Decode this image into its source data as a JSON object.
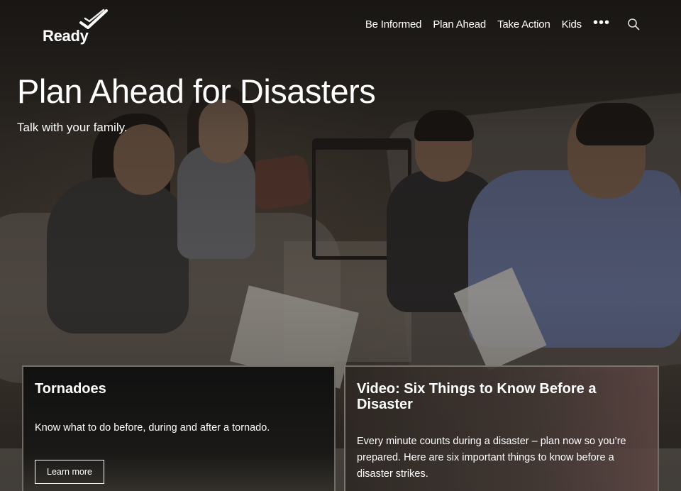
{
  "header": {
    "logo_text": "Ready",
    "nav": [
      "Be Informed",
      "Plan Ahead",
      "Take Action",
      "Kids"
    ],
    "more_label": "•••",
    "icons": {
      "more": "more-dots-icon",
      "search": "search-icon"
    }
  },
  "hero": {
    "title": "Plan Ahead for Disasters",
    "subtitle": "Talk with your family."
  },
  "cards": [
    {
      "title": "Tornadoes",
      "text": "Know what to do before, during and after a tornado.",
      "button": "Learn more"
    },
    {
      "title": "Video: Six Things to Know Before a Disaster",
      "text": "Every minute counts during a disaster – plan now so you’re prepared. Here are six important things to know before a disaster strikes."
    }
  ],
  "colors": {
    "text": "#ffffff",
    "overlay": "#141210"
  }
}
